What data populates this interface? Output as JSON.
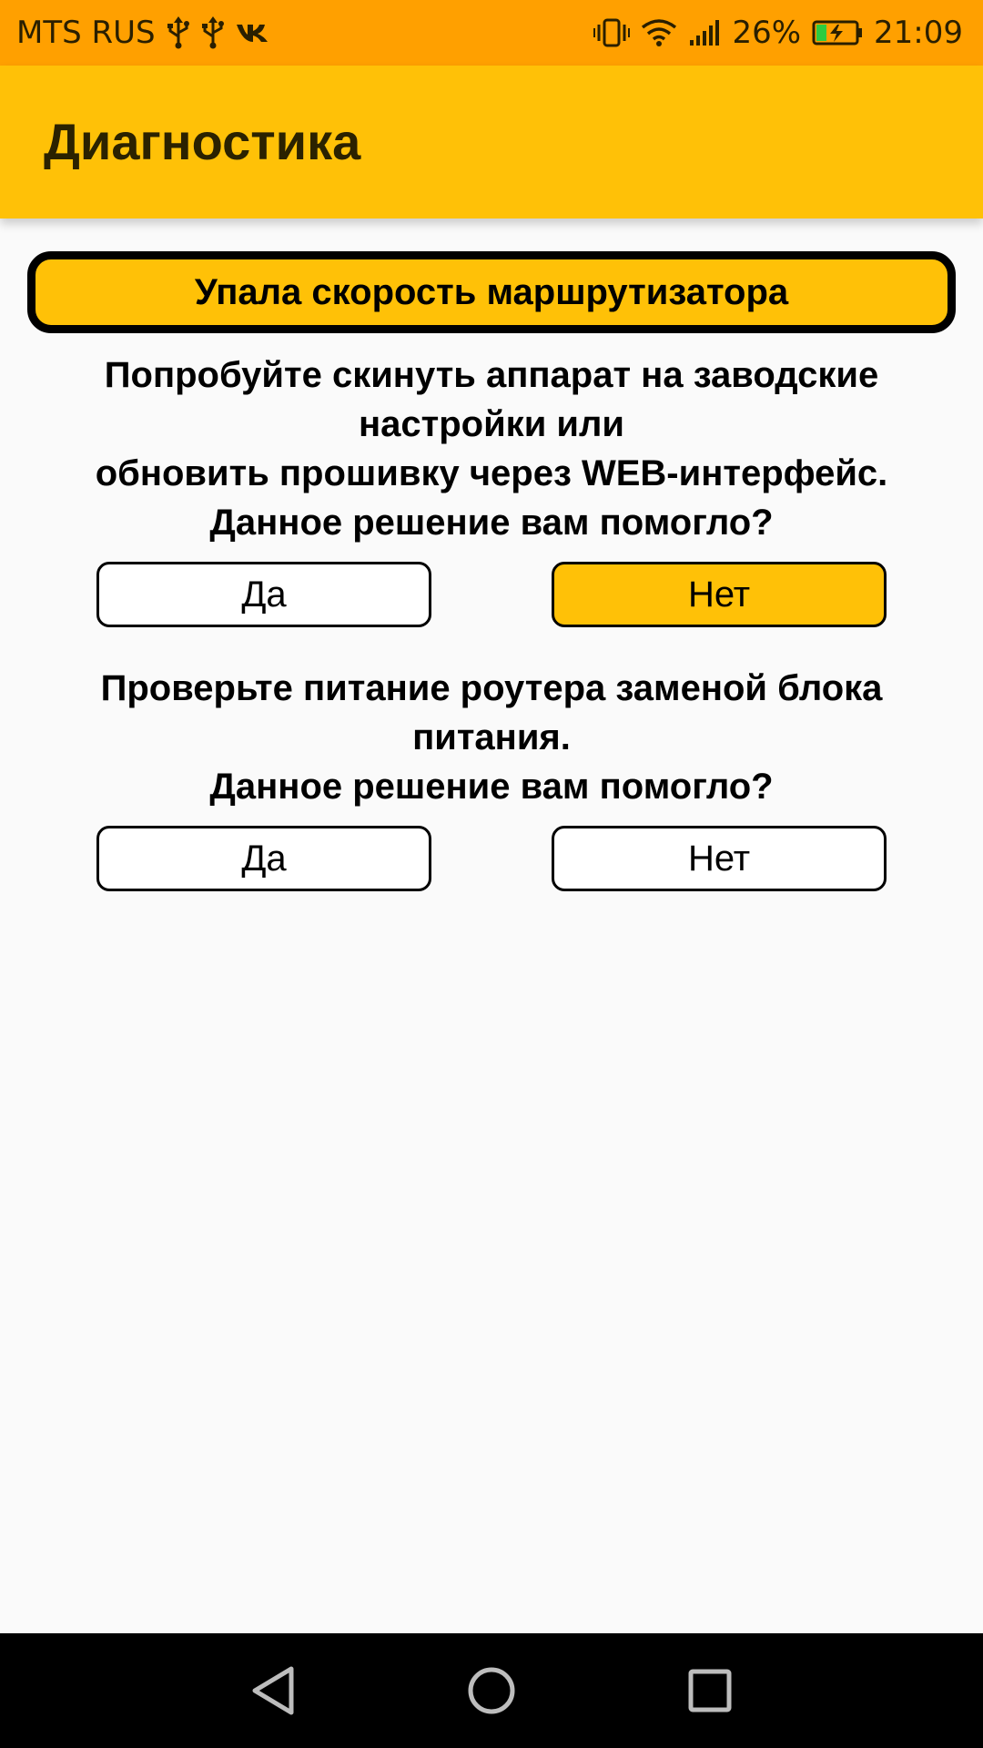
{
  "status_bar": {
    "carrier": "MTS RUS",
    "battery_percent": "26%",
    "time": "21:09",
    "icons_left": [
      "usb-icon",
      "usb-icon",
      "vk-icon"
    ],
    "icons_right": [
      "vibrate-icon",
      "wifi-icon",
      "signal-icon",
      "battery-charging-icon"
    ],
    "battery_level": 0.26
  },
  "app_bar": {
    "title": "Диагностика"
  },
  "problem": {
    "title": "Упала скорость маршрутизатора"
  },
  "solutions": [
    {
      "lines": [
        "Попробуйте скинуть аппарат на заводские",
        "настройки или",
        "обновить прошивку через WEB-интерфейс.",
        "Данное решение вам помогло?"
      ],
      "yes_label": "Да",
      "no_label": "Нет",
      "selected": "no"
    },
    {
      "lines": [
        "Проверьте питание роутера заменой блока",
        "питания.",
        "Данное решение вам помогло?"
      ],
      "yes_label": "Да",
      "no_label": "Нет",
      "selected": "none"
    }
  ],
  "colors": {
    "status_bar": "#ffa000",
    "app_bar": "#ffc107",
    "selected_button": "#ffc107",
    "background": "#fafafa",
    "nav_bar": "#000000"
  },
  "nav_bar": {
    "buttons": [
      "back-icon",
      "home-icon",
      "recents-icon"
    ]
  }
}
